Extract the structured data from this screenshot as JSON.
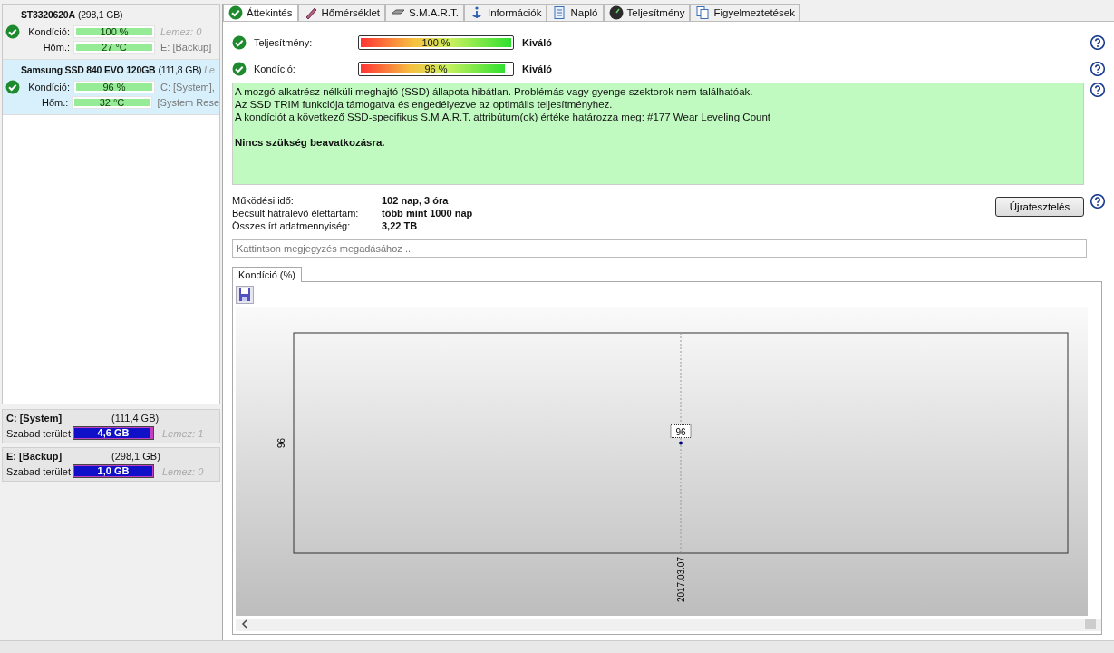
{
  "disks": [
    {
      "name": "ST3320620A",
      "size": "(298,1 GB)",
      "selected": false,
      "ok": true,
      "rows": [
        {
          "label": "Kondíció:",
          "value": "100 %",
          "level": 1,
          "side": "Lemez: 0",
          "muted": true
        },
        {
          "label": "Hőm.:",
          "value": "27 °C",
          "level": 1,
          "side": "E: [Backup]",
          "muted": false
        }
      ]
    },
    {
      "name": "Samsung SSD 840 EVO 120GB",
      "size": "(111,8 GB)",
      "note": "Le",
      "selected": true,
      "ok": true,
      "rows": [
        {
          "label": "Kondíció:",
          "value": "96 %",
          "level": 1,
          "side": "C: [System],",
          "muted": false
        },
        {
          "label": "Hőm.:",
          "value": "32 °C",
          "level": 1,
          "side": "[System Rese",
          "muted": false
        }
      ]
    }
  ],
  "volumes": [
    {
      "name": "C: [System]",
      "size": "(111,4 GB)",
      "label": "Szabad terület",
      "value": "4,6 GB",
      "level": 0.97,
      "disk": "Lemez: 1"
    },
    {
      "name": "E: [Backup]",
      "size": "(298,1 GB)",
      "label": "Szabad terület",
      "value": "1,0 GB",
      "level": 1,
      "disk": "Lemez: 0"
    }
  ],
  "tabs": [
    {
      "label": "Áttekintés",
      "selected": true
    },
    {
      "label": "Hőmérséklet",
      "selected": false
    },
    {
      "label": "S.M.A.R.T.",
      "selected": false
    },
    {
      "label": "Információk",
      "selected": false
    },
    {
      "label": "Napló",
      "selected": false
    },
    {
      "label": "Teljesítmény",
      "selected": false
    },
    {
      "label": "Figyelmeztetések",
      "selected": false
    }
  ],
  "metrics": [
    {
      "label": "Teljesítmény:",
      "value": "100 %",
      "level": 1,
      "rating": "Kiváló",
      "ok": true
    },
    {
      "label": "Kondíció:",
      "value": "96 %",
      "level": 0.96,
      "rating": "Kiváló",
      "ok": true
    }
  ],
  "status_text": [
    "A mozgó alkatrész nélküli meghajtó (SSD) állapota hibátlan. Problémás vagy gyenge szektorok nem találhatóak.",
    "Az SSD TRIM funkciója támogatva és engedélyezve az optimális teljesítményhez.",
    "A kondíciót a következő SSD-specifikus S.M.A.R.T. attribútum(ok) értéke határozza meg:  #177 Wear Leveling Count"
  ],
  "status_conclusion": "Nincs szükség beavatkozásra.",
  "details": [
    {
      "label": "Működési idő:",
      "value": "102 nap, 3 óra"
    },
    {
      "label": "Becsült hátralévő élettartam:",
      "value": "több mint 1000 nap"
    },
    {
      "label": "Összes írt adatmennyiség:",
      "value": "3,22 TB"
    }
  ],
  "retest_button": "Újratesztelés",
  "note_field": {
    "placeholder": "Kattintson megjegyzés megadásához ..."
  },
  "chart_tab": {
    "label": "Kondíció  (%)",
    "selected": true
  },
  "chart": {
    "y_label": "96",
    "x_label": "2017.03.07",
    "point_label": "96"
  }
}
